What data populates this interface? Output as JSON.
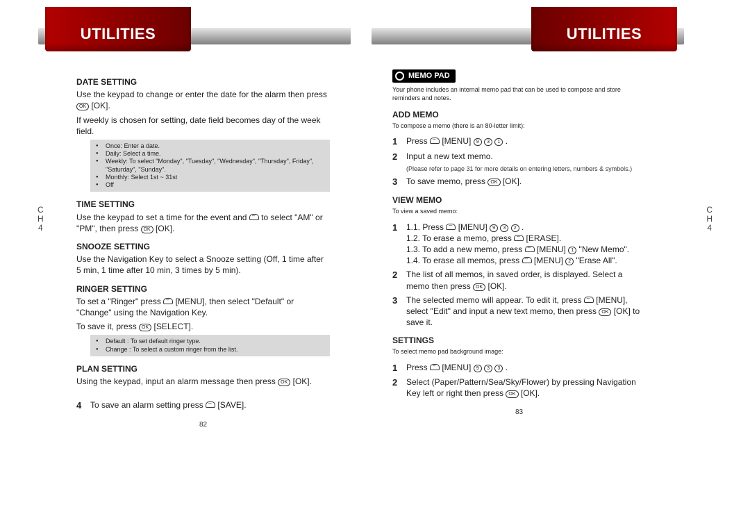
{
  "header": {
    "title_left": "UTILITIES",
    "title_right": "UTILITIES"
  },
  "side_tabs": {
    "left": "C\nH\n4",
    "right": "C\nH\n4"
  },
  "left_page": {
    "date": {
      "heading": "DATE SETTING",
      "body1": "Use the keypad to change or enter the date for the alarm then press ",
      "body1b": " [OK].",
      "body2": "If weekly is chosen for setting, date field becomes day of the week field.",
      "notes": {
        "l1": "Once: Enter a date.",
        "l2": "Daily: Select a time.",
        "l3": "Weekly: To select \"Monday\", \"Tuesday\", \"Wednesday\", \"Thursday\", Friday\", \"Saturday\", \"Sunday\".",
        "l4": "Monthly: Select 1st ~ 31st",
        "l5": "Off"
      }
    },
    "time": {
      "heading": "TIME SETTING",
      "body": "Use the keypad to set a time for the event and ",
      "body_mid": " to select \"AM\" or \"PM\", then press ",
      "body_end": " [OK]."
    },
    "snooze": {
      "heading": "SNOOZE SETTING",
      "body": "Use the Navigation Key to select a Snooze setting (Off, 1 time after 5 min, 1 time after 10 min, 3 times by 5 min)."
    },
    "ringer": {
      "heading": "RINGER SETTING",
      "body1": "To set a \"Ringer\" press ",
      "body1b": " [MENU], then select \"Default\" or \"Change\" using the Navigation Key.",
      "body2a": "To save it, press ",
      "body2b": " [SELECT].",
      "notes": {
        "l1": "Default : To set default ringer type.",
        "l2": "Change : To select a custom ringer from the list."
      }
    },
    "plan": {
      "heading": "PLAN SETTING",
      "body1": "Using the keypad, input an alarm message then press ",
      "body1b": " [OK]."
    },
    "save_step": {
      "n": "4",
      "text_a": "To save an alarm setting press ",
      "text_b": " [SAVE]."
    },
    "page_num": "82"
  },
  "right_page": {
    "chip": {
      "label": "MEMO PAD"
    },
    "chip_intro": "Your phone includes an internal memo pad that can be used to compose and store reminders and notes.",
    "add": {
      "heading": "ADD MEMO",
      "intro": "To compose a memo (there is an 80-letter limit):",
      "s1": {
        "n": "1",
        "a": "Press ",
        "b": " [MENU] ",
        "c": " ."
      },
      "s2": {
        "n": "2",
        "a": "Input a new text memo.",
        "note": "(Please refer to page 31 for more details on entering letters, numbers & symbols.)"
      },
      "s3": {
        "n": "3",
        "a": "To save memo, press ",
        "b": " [OK]."
      }
    },
    "view": {
      "heading": "VIEW MEMO",
      "intro": "To view a saved memo:",
      "s1": {
        "n": "1",
        "l1a": "1.1. Press ",
        "l1b": " [MENU] ",
        "l1c": " .",
        "l2a": "1.2. To erase a memo, press ",
        "l2b": " [ERASE].",
        "l3a": "1.3. To add a new memo, press ",
        "l3b": " [MENU] ",
        "l3c": " \"New Memo\".",
        "l4a": "1.4. To erase all memos, press ",
        "l4b": " [MENU] ",
        "l4c": " \"Erase All\"."
      },
      "s2": {
        "n": "2",
        "a": "The list of all memos, in saved order, is displayed. Select a memo then press ",
        "b": " [OK]."
      },
      "s3": {
        "n": "3",
        "a": "The selected memo will appear.  To edit it, press ",
        "b": " [MENU], select \"Edit\" and input a new text memo, then press ",
        "c": " [OK] to save it."
      }
    },
    "settings": {
      "heading": "SETTINGS",
      "intro": "To select memo pad background image:",
      "s1": {
        "n": "1",
        "a": "Press ",
        "b": " [MENU] ",
        "c": " ."
      },
      "s2": {
        "n": "2",
        "a": "Select (Paper/Pattern/Sea/Sky/Flower) by pressing Navigation Key left or right then press ",
        "b": " [OK]."
      }
    },
    "page_num": "83"
  }
}
